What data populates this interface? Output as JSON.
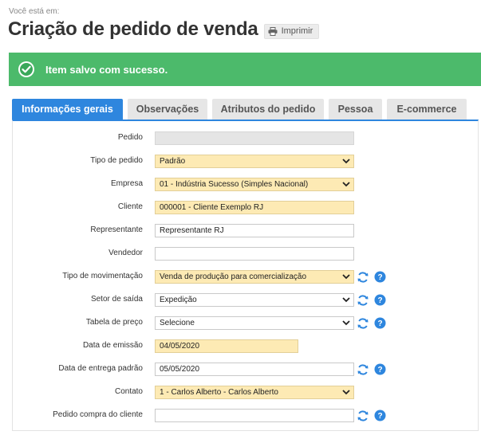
{
  "header": {
    "breadcrumb": "Você está em:",
    "title": "Criação de pedido de venda",
    "print_label": "Imprimir"
  },
  "alert": {
    "message": "Item salvo com sucesso.",
    "color": "#4cba6b"
  },
  "tabs": [
    {
      "label": "Informações gerais",
      "active": true
    },
    {
      "label": "Observações"
    },
    {
      "label": "Atributos do pedido"
    },
    {
      "label": "Pessoa"
    },
    {
      "label": "E-commerce"
    }
  ],
  "form": {
    "pedido": {
      "label": "Pedido",
      "value": ""
    },
    "tipo_pedido": {
      "label": "Tipo de pedido",
      "value": "Padrão"
    },
    "empresa": {
      "label": "Empresa",
      "value": "01 - Indústria Sucesso (Simples Nacional)"
    },
    "cliente": {
      "label": "Cliente",
      "value": "000001 - Cliente Exemplo RJ"
    },
    "representante": {
      "label": "Representante",
      "value": "Representante RJ"
    },
    "vendedor": {
      "label": "Vendedor",
      "value": ""
    },
    "tipo_movimentacao": {
      "label": "Tipo de movimentação",
      "value": "Venda de produção para comercialização"
    },
    "setor_saida": {
      "label": "Setor de saída",
      "value": "Expedição"
    },
    "tabela_preco": {
      "label": "Tabela de preço",
      "value": "Selecione"
    },
    "data_emissao": {
      "label": "Data de emissão",
      "value": "04/05/2020"
    },
    "data_entrega": {
      "label": "Data de entrega padrão",
      "value": "05/05/2020"
    },
    "contato": {
      "label": "Contato",
      "value": "1 - Carlos Alberto - Carlos Alberto"
    },
    "pedido_compra": {
      "label": "Pedido compra do cliente",
      "value": ""
    }
  },
  "colors": {
    "accent": "#2e86de",
    "required_field": "#fdeab4",
    "icon_blue": "#2e86de"
  }
}
